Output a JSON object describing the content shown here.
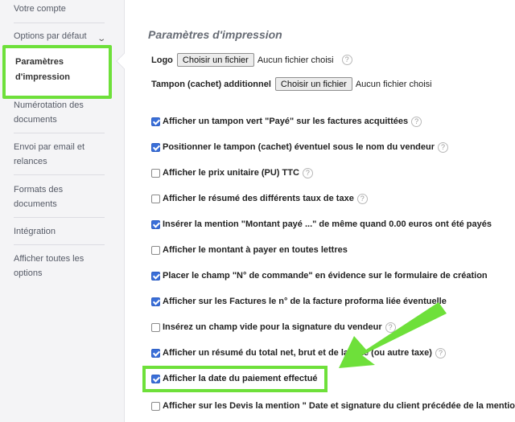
{
  "sidebar": {
    "items": [
      {
        "label": "Votre compte"
      },
      {
        "label": "Options par défaut"
      },
      {
        "label_lines": [
          "Paramètres",
          "d'impression"
        ]
      },
      {
        "label_lines": [
          "Numérotation des",
          "documents"
        ]
      },
      {
        "label_lines": [
          "Envoi par email et",
          "relances"
        ]
      },
      {
        "label_lines": [
          "Formats des",
          "documents"
        ]
      },
      {
        "label": "Intégration"
      },
      {
        "label_lines": [
          "Afficher toutes les",
          "options"
        ]
      }
    ]
  },
  "main": {
    "title": "Paramètres d'impression",
    "logo": {
      "label": "Logo",
      "button": "Choisir un fichier",
      "status": "Aucun fichier choisi"
    },
    "stamp": {
      "label": "Tampon (cachet) additionnel",
      "button": "Choisir un fichier",
      "status": "Aucun fichier choisi"
    },
    "options": [
      {
        "label": "Afficher un tampon vert \"Payé\" sur les factures acquittées",
        "checked": true,
        "help": true
      },
      {
        "label": "Positionner le tampon (cachet) éventuel sous le nom du vendeur",
        "checked": true,
        "help": true
      },
      {
        "label": "Afficher le prix unitaire (PU) TTC",
        "checked": false,
        "help": true
      },
      {
        "label": "Afficher le résumé des différents taux de taxe",
        "checked": false,
        "help": true
      },
      {
        "label": "Insérer la mention \"Montant payé ...\" de même quand 0.00 euros ont été payés",
        "checked": true,
        "help": false
      },
      {
        "label": "Afficher le montant à payer en toutes lettres",
        "checked": false,
        "help": false
      },
      {
        "label": "Placer le champ \"N° de commande\" en évidence sur le formulaire de création",
        "checked": true,
        "help": false
      },
      {
        "label": "Afficher sur les Factures le n° de la facture proforma liée éventuelle",
        "checked": true,
        "help": false
      },
      {
        "label": "Insérez un champ vide pour la signature du vendeur",
        "checked": false,
        "help": true
      },
      {
        "label": "Afficher un résumé du total net, brut et de la taxe (ou autre taxe)",
        "checked": true,
        "help": true
      },
      {
        "label": "Afficher la date du paiement effectué",
        "checked": true,
        "help": false
      },
      {
        "label": "Afficher sur les Devis la mention \" Date et signature du client précédée de la mention",
        "checked": false,
        "help": false
      }
    ],
    "help_glyph": "?"
  },
  "colors": {
    "highlight": "#6ee03a",
    "checkbox": "#3a6fd8",
    "sidebar_bg": "#f4f4f6"
  },
  "icons": {
    "chevron": "chevron-down-icon",
    "help": "question-circle-icon",
    "annotation": "green-arrow-icon"
  }
}
